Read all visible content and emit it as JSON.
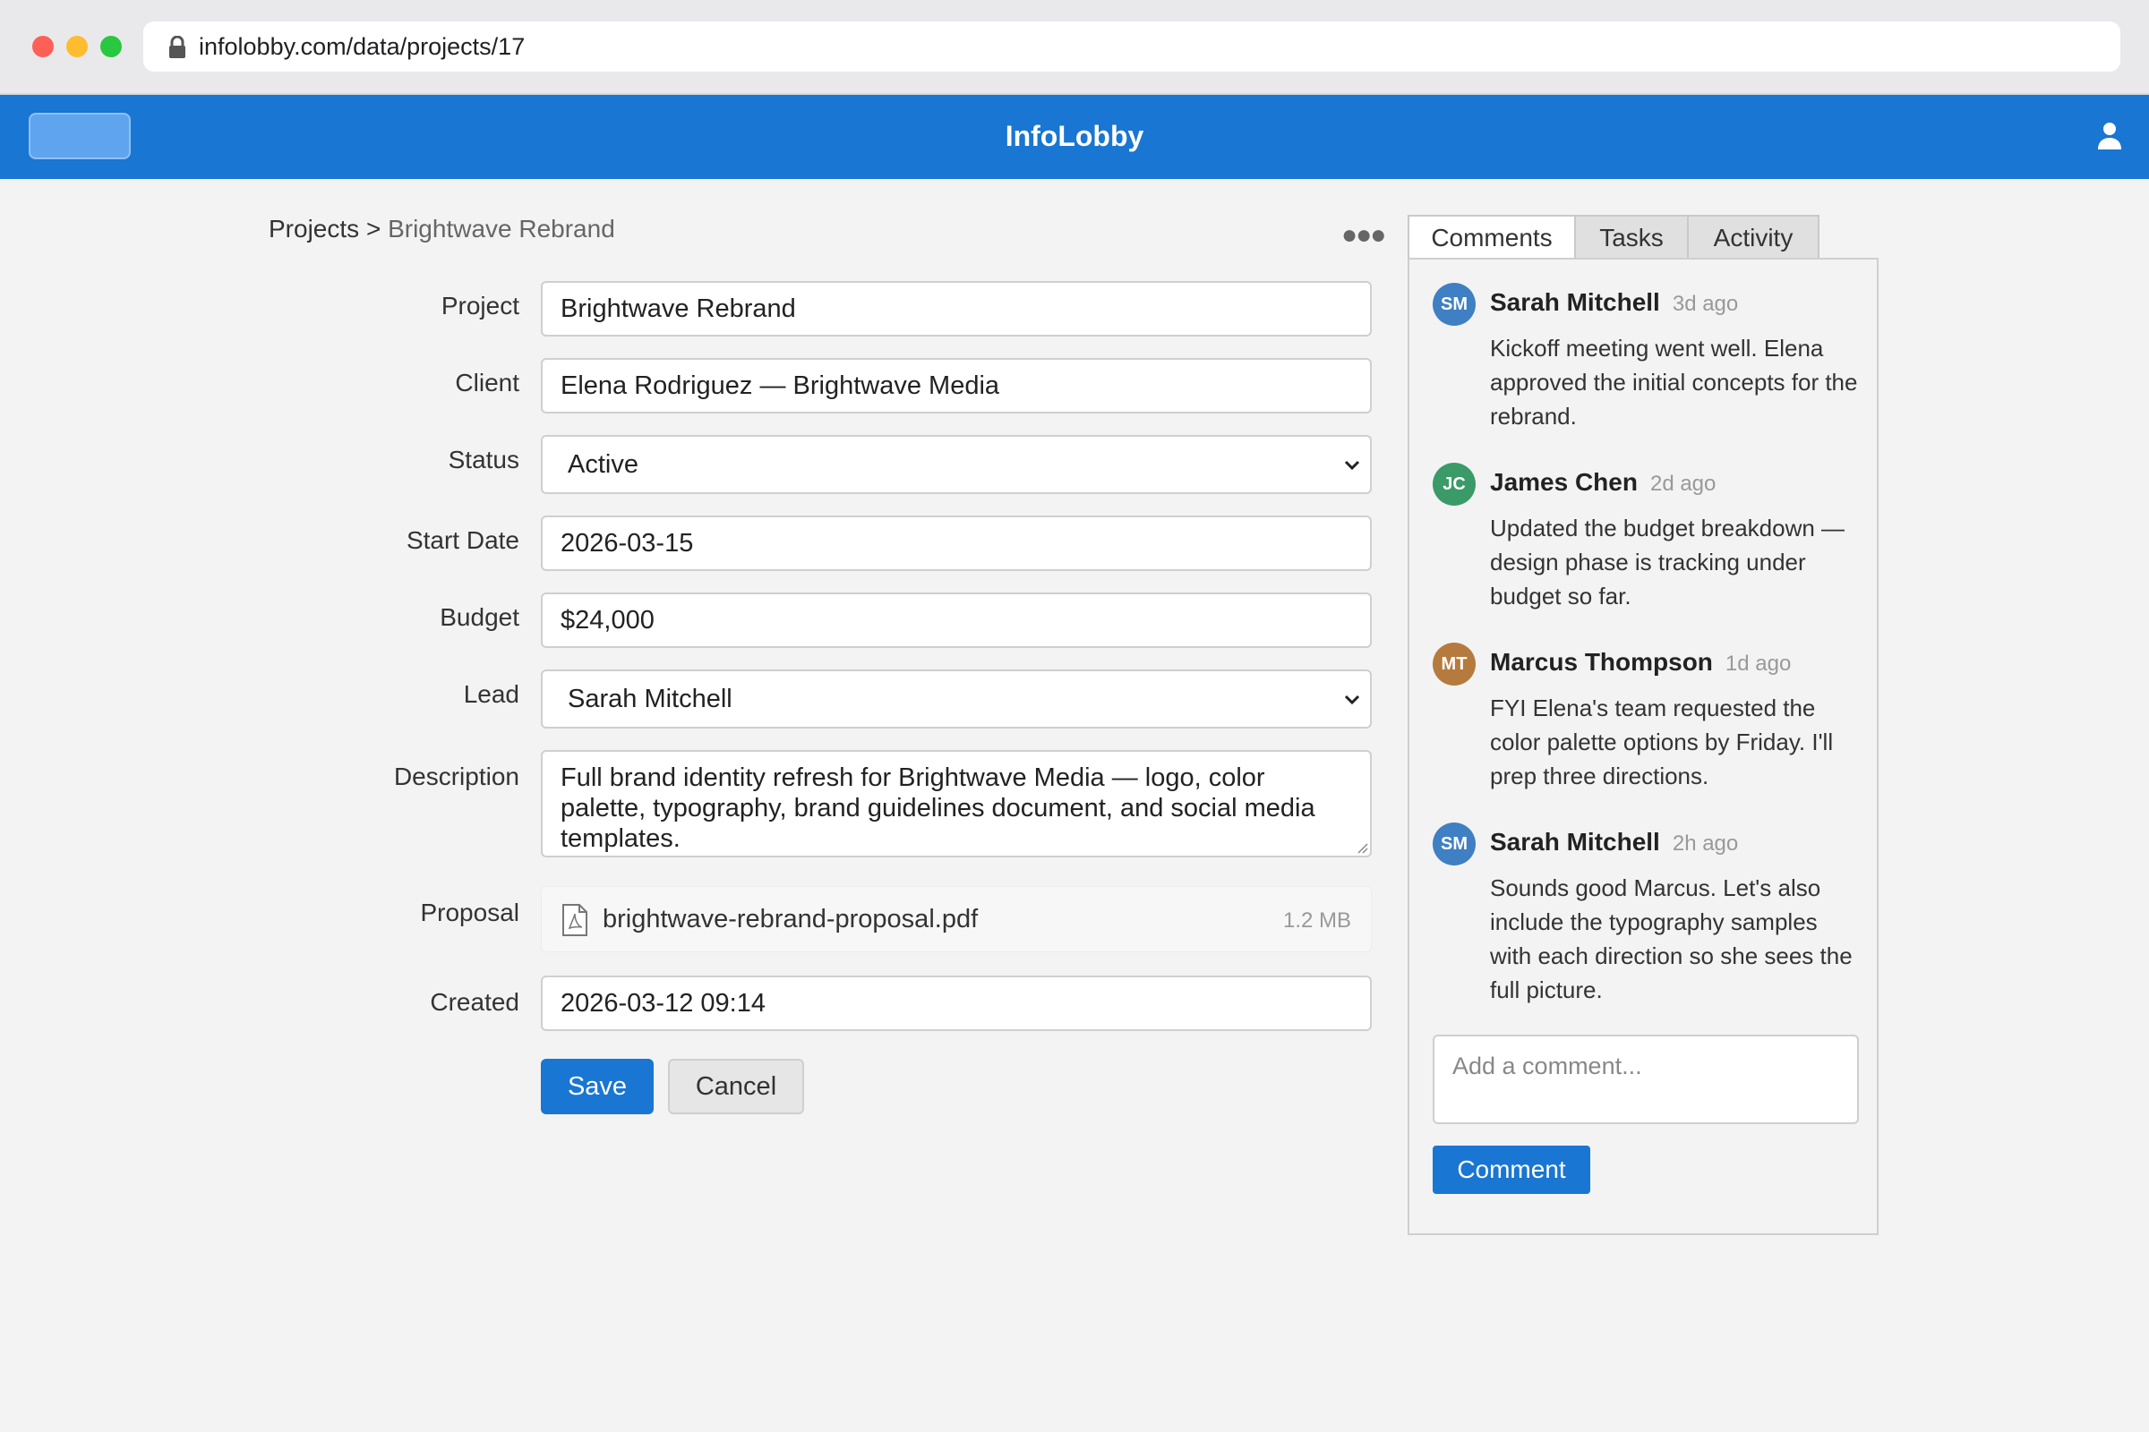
{
  "browser": {
    "url": "infolobby.com/data/projects/17"
  },
  "app": {
    "title": "InfoLobby"
  },
  "breadcrumb": {
    "root": "Projects",
    "separator": ">",
    "current": "Brightwave Rebrand"
  },
  "form": {
    "project": {
      "label": "Project",
      "value": "Brightwave Rebrand"
    },
    "client": {
      "label": "Client",
      "value": "Elena Rodriguez — Brightwave Media"
    },
    "status": {
      "label": "Status",
      "value": "Active"
    },
    "start_date": {
      "label": "Start Date",
      "value": "2026-03-15"
    },
    "budget": {
      "label": "Budget",
      "value": "$24,000"
    },
    "lead": {
      "label": "Lead",
      "value": "Sarah Mitchell"
    },
    "description": {
      "label": "Description",
      "value": "Full brand identity refresh for Brightwave Media — logo, color palette, typography, brand guidelines document, and social media templates."
    },
    "proposal": {
      "label": "Proposal",
      "file_name": "brightwave-rebrand-proposal.pdf",
      "file_size": "1.2 MB"
    },
    "created": {
      "label": "Created",
      "value": "2026-03-12 09:14"
    },
    "save_label": "Save",
    "cancel_label": "Cancel"
  },
  "panel": {
    "tabs": [
      {
        "label": "Comments",
        "active": true
      },
      {
        "label": "Tasks",
        "active": false
      },
      {
        "label": "Activity",
        "active": false
      }
    ],
    "comments": [
      {
        "initials": "SM",
        "avatar_color": "#3f7fc4",
        "author": "Sarah Mitchell",
        "time": "3d ago",
        "text": "Kickoff meeting went well. Elena approved the initial concepts for the rebrand."
      },
      {
        "initials": "JC",
        "avatar_color": "#3a9a68",
        "author": "James Chen",
        "time": "2d ago",
        "text": "Updated the budget breakdown — design phase is tracking under budget so far."
      },
      {
        "initials": "MT",
        "avatar_color": "#b57a3e",
        "author": "Marcus Thompson",
        "time": "1d ago",
        "text": "FYI Elena's team requested the color palette options by Friday. I'll prep three directions."
      },
      {
        "initials": "SM",
        "avatar_color": "#3f7fc4",
        "author": "Sarah Mitchell",
        "time": "2h ago",
        "text": "Sounds good Marcus. Let's also include the typography samples with each direction so she sees the full picture."
      }
    ],
    "comment_placeholder": "Add a comment...",
    "comment_button": "Comment"
  },
  "colors": {
    "primary": "#1976d2",
    "background": "#f3f3f3"
  }
}
